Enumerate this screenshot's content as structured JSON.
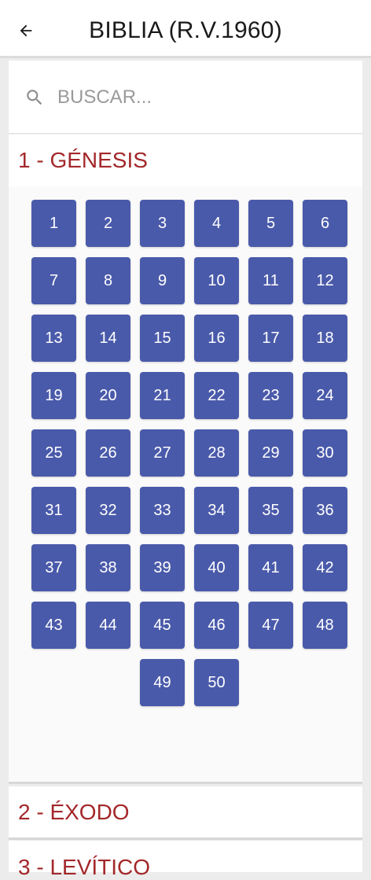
{
  "app_bar": {
    "title": "BIBLIA (R.V.1960)"
  },
  "search": {
    "placeholder": "BUSCAR..."
  },
  "books": [
    {
      "title": "1 - GÉNESIS",
      "chapters": [
        "1",
        "2",
        "3",
        "4",
        "5",
        "6",
        "7",
        "8",
        "9",
        "10",
        "11",
        "12",
        "13",
        "14",
        "15",
        "16",
        "17",
        "18",
        "19",
        "20",
        "21",
        "22",
        "23",
        "24",
        "25",
        "26",
        "27",
        "28",
        "29",
        "30",
        "31",
        "32",
        "33",
        "34",
        "35",
        "36",
        "37",
        "38",
        "39",
        "40",
        "41",
        "42",
        "43",
        "44",
        "45",
        "46",
        "47",
        "48",
        "49",
        "50"
      ]
    },
    {
      "title": "2 - ÉXODO"
    },
    {
      "title": "3 - LEVÍTICO"
    }
  ],
  "colors": {
    "accent_title": "#a3282b",
    "chapter_button": "#4a5aaa"
  },
  "icons": {
    "back": "arrow-back-icon",
    "search": "search-icon"
  }
}
